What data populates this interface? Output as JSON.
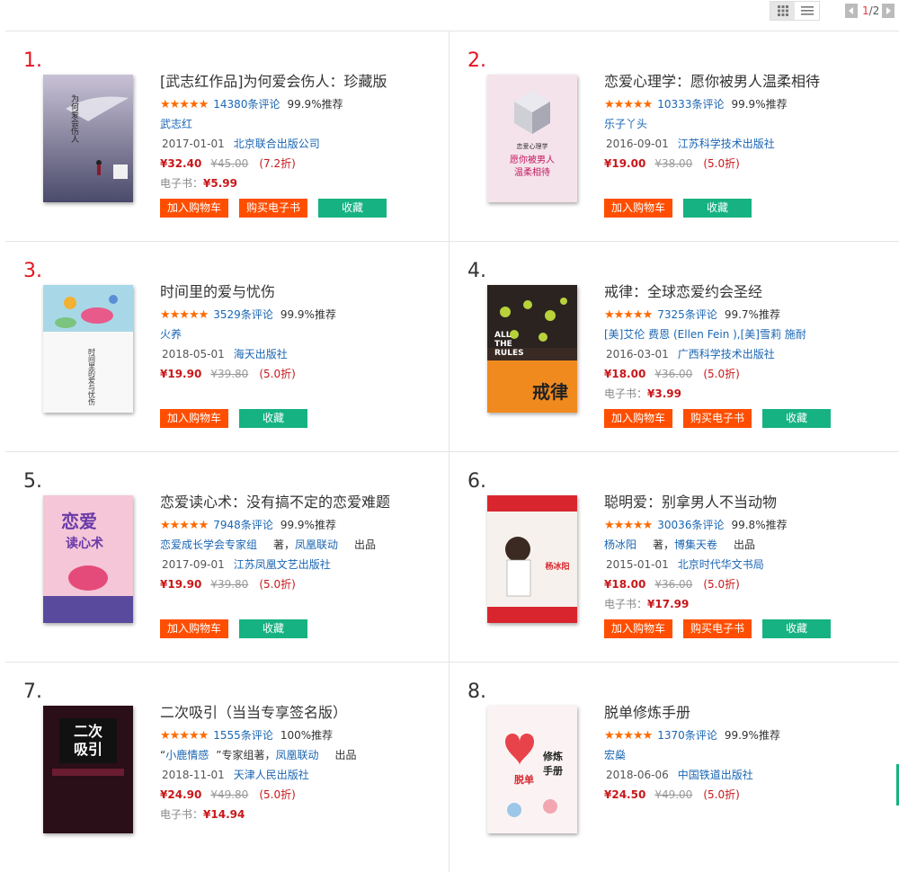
{
  "toolbar": {
    "view_grid_icon": "grid-view-icon",
    "view_list_icon": "list-view-icon",
    "pager_current": "1",
    "pager_total": "/2",
    "prev_icon": "prev-page-icon",
    "next_icon": "next-page-icon"
  },
  "colors": {
    "accent": "#ff4e00",
    "green": "#16b281",
    "link": "#1a66b3",
    "price": "#c8171a"
  },
  "books": [
    {
      "rank": "1.",
      "title": "[武志红作品]为何爱会伤人：珍藏版",
      "stars": "★★★★★",
      "reviews": "14380条评论",
      "recommend": "99.9%推荐",
      "author": "武志红",
      "date": "2017-01-01",
      "publisher": "北京联合出版公司",
      "price": "¥32.40",
      "orig_price": "¥45.00",
      "discount": "(7.2折)",
      "ebook_label": "电子书：",
      "ebook_price": "¥5.99",
      "buttons": [
        "加入购物车",
        "购买电子书",
        "收藏"
      ]
    },
    {
      "rank": "2.",
      "title": "恋爱心理学：愿你被男人温柔相待",
      "stars": "★★★★★",
      "reviews": "10333条评论",
      "recommend": "99.9%推荐",
      "author": "乐子丫头",
      "date": "2016-09-01",
      "publisher": "江苏科学技术出版社",
      "price": "¥19.00",
      "orig_price": "¥38.00",
      "discount": "(5.0折)",
      "buttons": [
        "加入购物车",
        "收藏"
      ]
    },
    {
      "rank": "3.",
      "title": "时间里的爱与忧伤",
      "stars": "★★★★★",
      "reviews": "3529条评论",
      "recommend": "99.9%推荐",
      "author": "火养",
      "date": "2018-05-01",
      "publisher": "海天出版社",
      "price": "¥19.90",
      "orig_price": "¥39.80",
      "discount": "(5.0折)",
      "buttons": [
        "加入购物车",
        "收藏"
      ]
    },
    {
      "rank": "4.",
      "title": "戒律：全球恋爱约会圣经",
      "stars": "★★★★★",
      "reviews": "7325条评论",
      "recommend": "99.7%推荐",
      "author": "[美]艾伦 费恩 (Ellen Fein ),[美]雪莉 施耐",
      "date": "2016-03-01",
      "publisher": "广西科学技术出版社",
      "price": "¥18.00",
      "orig_price": "¥36.00",
      "discount": "(5.0折)",
      "ebook_label": "电子书：",
      "ebook_price": "¥3.99",
      "buttons": [
        "加入购物车",
        "购买电子书",
        "收藏"
      ]
    },
    {
      "rank": "5.",
      "title": "恋爱读心术：没有搞不定的恋爱难题",
      "stars": "★★★★★",
      "reviews": "7948条评论",
      "recommend": "99.9%推荐",
      "author": "恋爱成长学会专家组",
      "author_suffix": "著，",
      "author2": "凤凰联动",
      "author2_suffix": "出品",
      "date": "2017-09-01",
      "publisher": "江苏凤凰文艺出版社",
      "price": "¥19.90",
      "orig_price": "¥39.80",
      "discount": "(5.0折)",
      "buttons": [
        "加入购物车",
        "收藏"
      ]
    },
    {
      "rank": "6.",
      "title": "聪明爱：别拿男人不当动物",
      "stars": "★★★★★",
      "reviews": "30036条评论",
      "recommend": "99.8%推荐",
      "author": "杨冰阳",
      "author_suffix": "著，",
      "author2": "博集天卷",
      "author2_suffix": "出品",
      "date": "2015-01-01",
      "publisher": "北京时代华文书局",
      "price": "¥18.00",
      "orig_price": "¥36.00",
      "discount": "(5.0折)",
      "ebook_label": "电子书：",
      "ebook_price": "¥17.99",
      "buttons": [
        "加入购物车",
        "购买电子书",
        "收藏"
      ]
    },
    {
      "rank": "7.",
      "title": "二次吸引（当当专享签名版）",
      "stars": "★★★★★",
      "reviews": "1555条评论",
      "recommend": "100%推荐",
      "author_prefix": "“",
      "author": "小鹿情感",
      "author_mid": "”专家组",
      "author_suffix": "著，",
      "author2": "凤凰联动",
      "author2_suffix": "出品",
      "date": "2018-11-01",
      "publisher": "天津人民出版社",
      "price": "¥24.90",
      "orig_price": "¥49.80",
      "discount": "(5.0折)",
      "ebook_label": "电子书：",
      "ebook_price": "¥14.94"
    },
    {
      "rank": "8.",
      "title": "脱单修炼手册",
      "stars": "★★★★★",
      "reviews": "1370条评论",
      "recommend": "99.9%推荐",
      "author": "宏燊",
      "date": "2018-06-06",
      "publisher": "中国铁道出版社",
      "price": "¥24.50",
      "orig_price": "¥49.00",
      "discount": "(5.0折)"
    }
  ],
  "covers": {
    "c1": {
      "title": "为何爱会伤人",
      "author": "武志红"
    },
    "c2": {
      "top": "恋爱心理学",
      "title1": "愿你被男人",
      "title2": "温柔相待"
    },
    "c3": {
      "title": "时间里的爱与忧伤"
    },
    "c4": {
      "en1": "ALL",
      "en2": "THE",
      "en3": "RULES",
      "title": "戒律"
    },
    "c5": {
      "title1": "恋爱",
      "title2": "读心术"
    },
    "c6": {
      "title": "杨冰阳"
    },
    "c7": {
      "title1": "二次",
      "title2": "吸引"
    },
    "c8": {
      "title1": "脱单",
      "title2": "修炼",
      "title3": "手册"
    }
  }
}
